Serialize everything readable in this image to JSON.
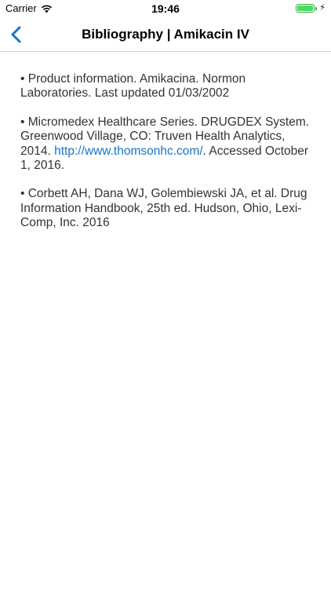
{
  "status_bar": {
    "carrier": "Carrier",
    "time": "19:46",
    "battery_level": 1.0,
    "battery_color": "#4cd964"
  },
  "nav": {
    "back_icon": "chevron-left-icon",
    "title": "Bibliography | Amikacin IV",
    "accent": "#1a73c8"
  },
  "references": [
    {
      "text": "• Product information. Amikacina. Normon Laboratories. Last updated 01/03/2002"
    },
    {
      "before": "• Micromedex Healthcare Series. DRUGDEX System. Greenwood Village, CO: Truven Health Analytics, 2014. ",
      "link": "http://www.thomsonhc.com/",
      "after": ". Accessed October 1, 2016."
    },
    {
      "text": "• Corbett AH, Dana WJ, Golembiewski JA, et al. Drug Information Handbook, 25th ed. Hudson, Ohio, Lexi-Comp, Inc. 2016"
    }
  ]
}
